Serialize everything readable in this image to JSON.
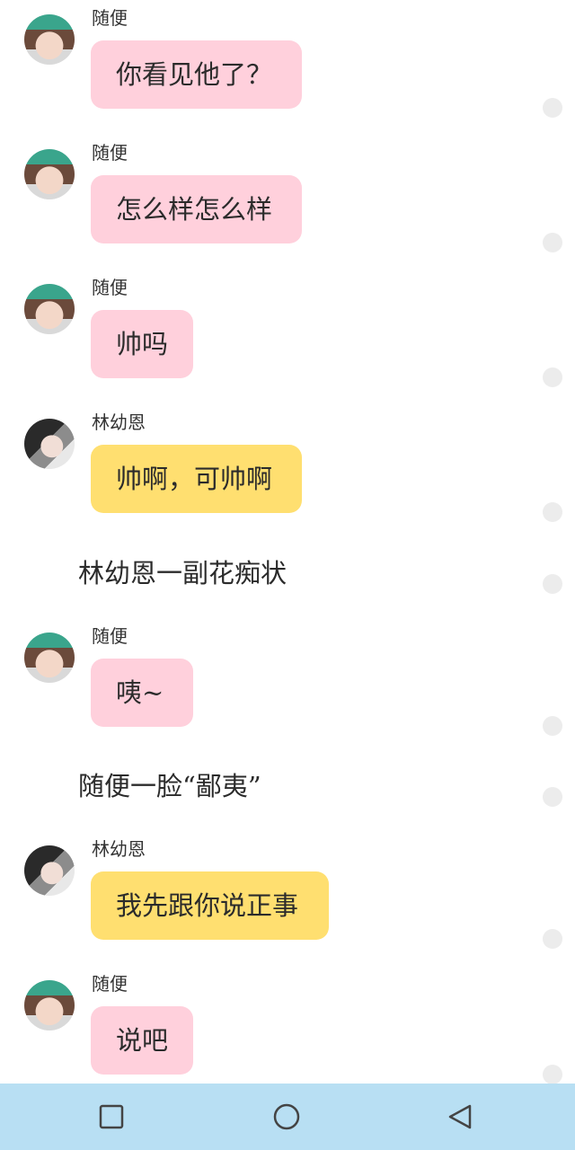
{
  "chat": {
    "messages": [
      {
        "sender": "随便",
        "text": "你看见他了？"
      },
      {
        "sender": "随便",
        "text": "怎么样怎么样"
      },
      {
        "sender": "随便",
        "text": "帅吗"
      },
      {
        "sender": "林幼恩",
        "text": "帅啊，可帅啊"
      },
      {
        "narration": "林幼恩一副花痴状"
      },
      {
        "sender": "随便",
        "text": "咦~"
      },
      {
        "narration": "随便一脸“鄙夷”"
      },
      {
        "sender": "林幼恩",
        "text": "我先跟你说正事"
      },
      {
        "sender": "随便",
        "text": "说吧"
      }
    ]
  },
  "colors": {
    "bubble_suibian": "#ffd0dc",
    "bubble_linyouen": "#ffdf70",
    "navbar": "#b8dff3"
  },
  "navbar": {
    "icons": [
      "recent-apps-square-icon",
      "home-circle-icon",
      "back-triangle-icon"
    ]
  }
}
